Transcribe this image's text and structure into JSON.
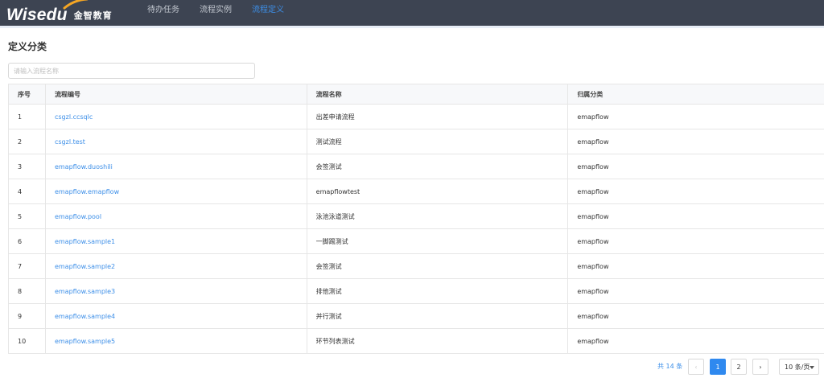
{
  "header": {
    "logo_brand": "Wisedu",
    "logo_cn": "金智教育",
    "nav": [
      {
        "label": "待办任务",
        "active": false
      },
      {
        "label": "流程实例",
        "active": false
      },
      {
        "label": "流程定义",
        "active": true
      }
    ]
  },
  "page": {
    "title": "定义分类",
    "search_placeholder": "请输入流程名称"
  },
  "table": {
    "columns": [
      "序号",
      "流程编号",
      "流程名称",
      "归属分类"
    ],
    "rows": [
      [
        "1",
        "csgzl.ccsqlc",
        "出差申请流程",
        "emapflow"
      ],
      [
        "2",
        "csgzl.test",
        "测试流程",
        "emapflow"
      ],
      [
        "3",
        "emapflow.duoshili",
        "会签测试",
        "emapflow"
      ],
      [
        "4",
        "emapflow.emapflow",
        "emapflowtest",
        "emapflow"
      ],
      [
        "5",
        "emapflow.pool",
        "泳池泳道测试",
        "emapflow"
      ],
      [
        "6",
        "emapflow.sample1",
        "一脚踢测试",
        "emapflow"
      ],
      [
        "7",
        "emapflow.sample2",
        "会签测试",
        "emapflow"
      ],
      [
        "8",
        "emapflow.sample3",
        "排他测试",
        "emapflow"
      ],
      [
        "9",
        "emapflow.sample4",
        "并行测试",
        "emapflow"
      ],
      [
        "10",
        "emapflow.sample5",
        "环节列表测试",
        "emapflow"
      ]
    ]
  },
  "pagination": {
    "total_text": "共 14 条",
    "prev": "‹",
    "pages": [
      "1",
      "2"
    ],
    "current": "1",
    "next": "›",
    "page_size": "10 条/页"
  },
  "colors": {
    "topbar": "#3d4452",
    "accent": "#3d8fe8",
    "active_page": "#2f89ef"
  }
}
